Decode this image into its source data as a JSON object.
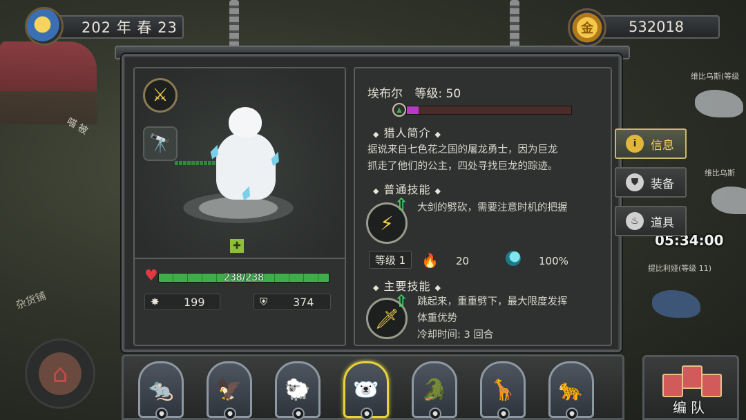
{
  "top_bar": {
    "date_text": "202 年 春 23",
    "gold_amount": "532018",
    "gold_symbol": "金"
  },
  "background": {
    "npc_label_1": "维比乌斯(等级",
    "npc_label_2": "维比乌斯",
    "npc_label_3": "提比利娅(等级 11)",
    "timer": "05:34:00",
    "shop_sign": "杂货铺",
    "street_sign": "喵 被"
  },
  "hero": {
    "name": "埃布尔",
    "level_label": "等级: 50",
    "xp_fraction": 0.07,
    "hp_text": "238/238",
    "hp_fraction": 1.0,
    "attack": "199",
    "defense": "374"
  },
  "info": {
    "intro_title": "猎人简介",
    "intro_text_line1": "据说来自七色花之国的屠龙勇士，因为巨龙",
    "intro_text_line2": "抓走了他们的公主，四处寻找巨龙的踪迹。",
    "normal_skill_title": "普通技能",
    "normal_skill_desc": "大剑的劈砍，需要注意时机的把握",
    "skill_level": "等级 1",
    "fire_value": "20",
    "crit_value": "100%",
    "main_skill_title": "主要技能",
    "main_skill_desc_line1": "跳起来，重重劈下，最大限度发挥",
    "main_skill_desc_line2": "体重优势",
    "cooldown": "冷却时间: 3 回合"
  },
  "tabs": {
    "info": "信息",
    "equipment": "装备",
    "items": "道具"
  },
  "roster": {
    "heroes": [
      {
        "name": "pirate-rat",
        "emoji": "🐀"
      },
      {
        "name": "eagle",
        "emoji": "🦅"
      },
      {
        "name": "sheep",
        "emoji": "🐑"
      },
      {
        "name": "polar-bear",
        "emoji": "🐻‍❄️"
      },
      {
        "name": "crocodile",
        "emoji": "🐊"
      },
      {
        "name": "giraffe",
        "emoji": "🦒"
      },
      {
        "name": "leopard",
        "emoji": "🐆"
      }
    ],
    "team_label": "编队"
  },
  "colors": {
    "accent_gold": "#e7d33c",
    "hp_green": "#3fae4a",
    "xp_purple": "#b43ac7",
    "panel_bg": "#2e312f"
  }
}
